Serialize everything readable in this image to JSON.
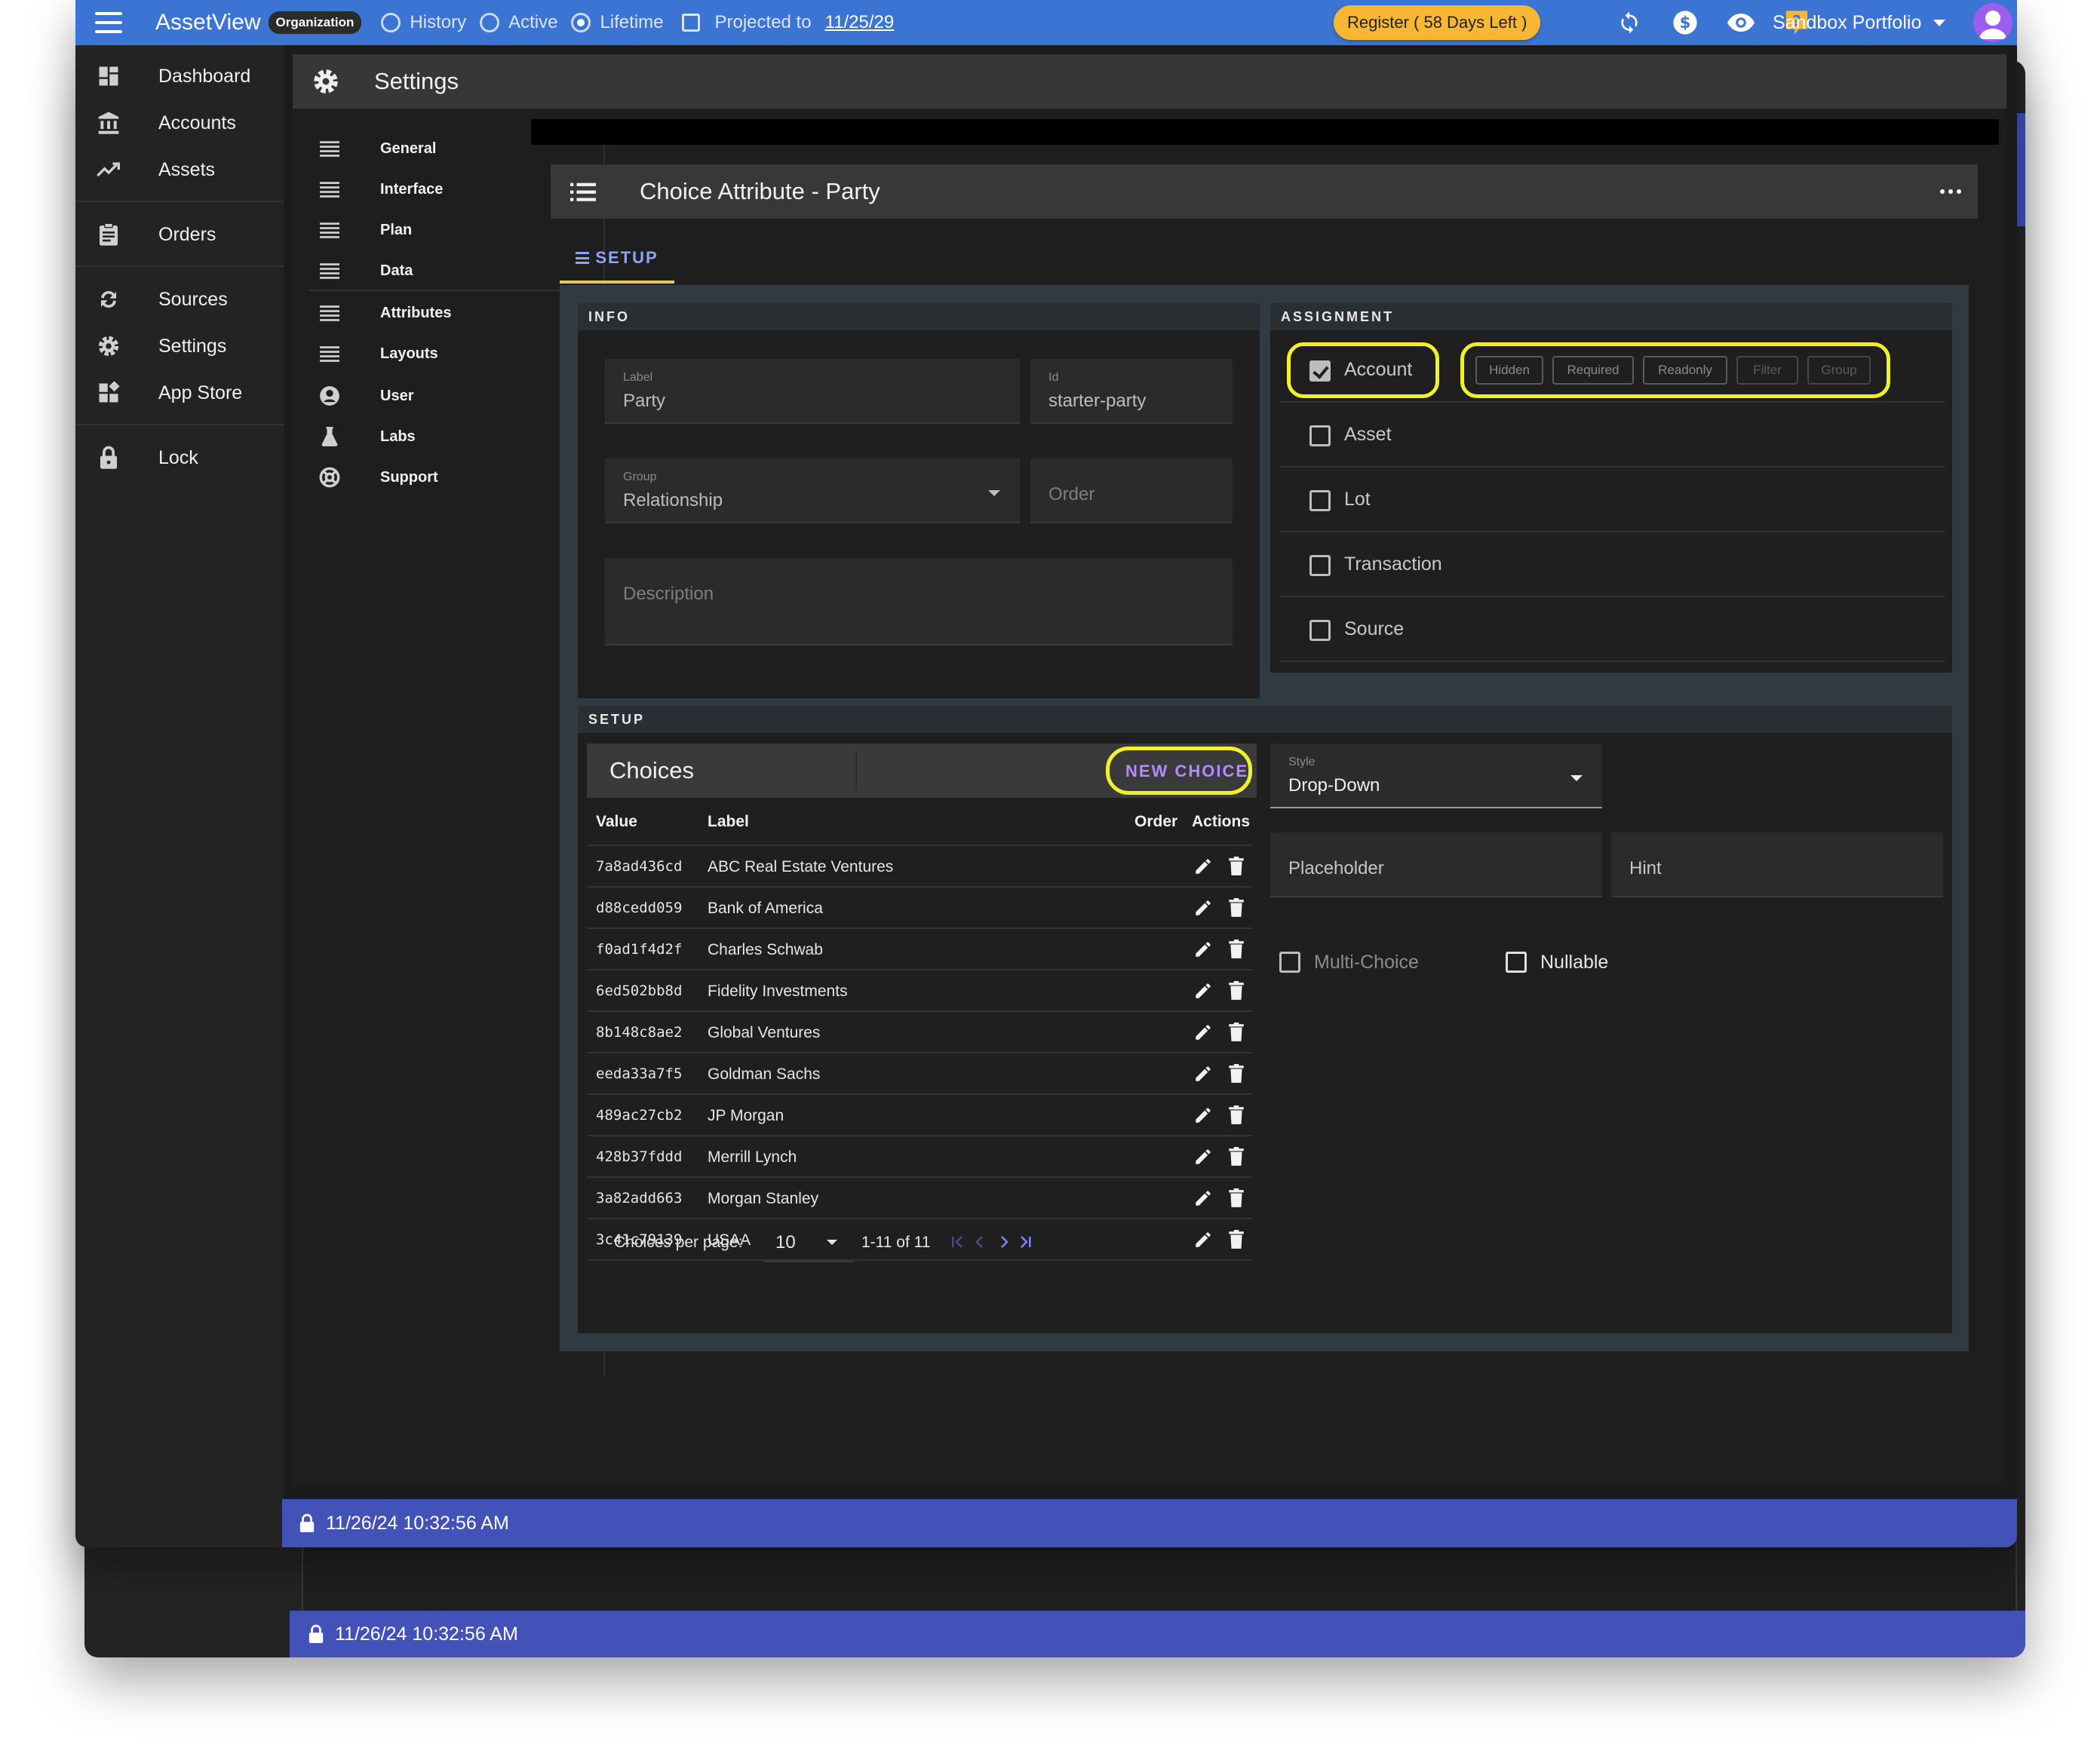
{
  "topbar": {
    "brand": "AssetView",
    "org_chip": "Organization",
    "modes": [
      {
        "label": "History",
        "selected": false
      },
      {
        "label": "Active",
        "selected": false
      },
      {
        "label": "Lifetime",
        "selected": true
      }
    ],
    "projected_label": "Projected to",
    "projected_date": "11/25/29",
    "register_label": "Register ( 58 Days Left )",
    "portfolio": "Sandbox Portfolio",
    "icons": [
      "sync-icon",
      "dollar-icon",
      "eye-icon",
      "help-icon",
      "user-avatar-icon"
    ]
  },
  "leftnav": {
    "items": [
      {
        "label": "Dashboard",
        "icon": "dashboard-icon"
      },
      {
        "label": "Accounts",
        "icon": "bank-icon"
      },
      {
        "label": "Assets",
        "icon": "trending-up-icon"
      },
      {
        "label": "Orders",
        "icon": "clipboard-icon"
      },
      {
        "label": "Sources",
        "icon": "sync-icon"
      },
      {
        "label": "Settings",
        "icon": "gear-icon"
      },
      {
        "label": "App Store",
        "icon": "widgets-icon"
      },
      {
        "label": "Lock",
        "icon": "lock-icon"
      }
    ]
  },
  "settings": {
    "title": "Settings",
    "subnav": [
      {
        "label": "General",
        "icon": "list-icon"
      },
      {
        "label": "Interface",
        "icon": "list-icon"
      },
      {
        "label": "Plan",
        "icon": "list-icon"
      },
      {
        "label": "Data",
        "icon": "list-icon"
      },
      {
        "label": "Attributes",
        "icon": "list-icon"
      },
      {
        "label": "Layouts",
        "icon": "list-icon"
      },
      {
        "label": "User",
        "icon": "account-circle-icon"
      },
      {
        "label": "Labs",
        "icon": "flask-icon"
      },
      {
        "label": "Support",
        "icon": "lifebuoy-icon"
      }
    ]
  },
  "attribute": {
    "title": "Choice Attribute - Party",
    "tab": "SETUP",
    "info": {
      "section_title": "INFO",
      "label_caption": "Label",
      "label_value": "Party",
      "id_caption": "Id",
      "id_value": "starter-party",
      "group_caption": "Group",
      "group_value": "Relationship",
      "order_placeholder": "Order",
      "description_placeholder": "Description"
    },
    "assignment": {
      "section_title": "ASSIGNMENT",
      "rows": [
        {
          "label": "Account",
          "checked": true
        },
        {
          "label": "Asset",
          "checked": false
        },
        {
          "label": "Lot",
          "checked": false
        },
        {
          "label": "Transaction",
          "checked": false
        },
        {
          "label": "Source",
          "checked": false
        }
      ],
      "flags": [
        "Hidden",
        "Required",
        "Readonly",
        "Filter",
        "Group"
      ]
    },
    "setup": {
      "section_title": "SETUP",
      "choices_title": "Choices",
      "new_choice_label": "NEW CHOICE",
      "columns": {
        "value": "Value",
        "label": "Label",
        "order": "Order",
        "actions": "Actions"
      },
      "rows": [
        {
          "value": "7a8ad436cd",
          "label": "ABC Real Estate Ventures"
        },
        {
          "value": "d88cedd059",
          "label": "Bank of America"
        },
        {
          "value": "f0ad1f4d2f",
          "label": "Charles Schwab"
        },
        {
          "value": "6ed502bb8d",
          "label": "Fidelity Investments"
        },
        {
          "value": "8b148c8ae2",
          "label": "Global Ventures"
        },
        {
          "value": "eeda33a7f5",
          "label": "Goldman Sachs"
        },
        {
          "value": "489ac27cb2",
          "label": "JP Morgan"
        },
        {
          "value": "428b37fddd",
          "label": "Merrill Lynch"
        },
        {
          "value": "3a82add663",
          "label": "Morgan Stanley"
        },
        {
          "value": "3c41c79139",
          "label": "USAA"
        }
      ],
      "per_page_label": "Choices per page:",
      "per_page_value": "10",
      "range_label": "1-11 of 11",
      "style_caption": "Style",
      "style_value": "Drop-Down",
      "placeholder_label": "Placeholder",
      "hint_label": "Hint",
      "multi_choice_label": "Multi-Choice",
      "nullable_label": "Nullable"
    }
  },
  "status": {
    "timestamp": "11/26/24 10:32:56 AM",
    "back_timestamp": "11/26/24 10:32:56 AM"
  },
  "colors": {
    "topbar": "#3b74d3",
    "statusbar": "#4352b8",
    "register": "#f7b733",
    "highlight": "#f1f12a",
    "accent_purple": "#b48bff"
  }
}
